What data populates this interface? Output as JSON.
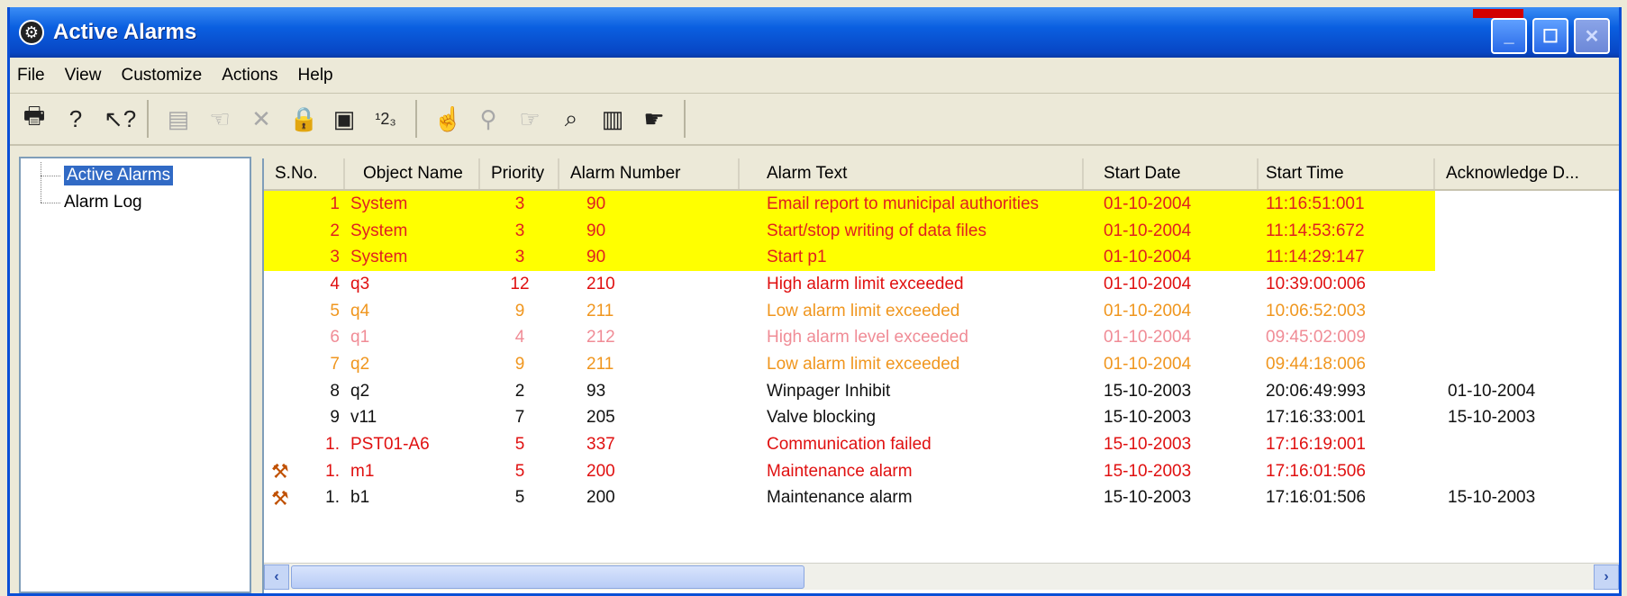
{
  "window": {
    "title": "Active Alarms"
  },
  "menu": [
    "File",
    "View",
    "Customize",
    "Actions",
    "Help"
  ],
  "tree": {
    "items": [
      {
        "label": "Active Alarms",
        "selected": true
      },
      {
        "label": "Alarm Log",
        "selected": false
      }
    ]
  },
  "table": {
    "columns": [
      "S.No.",
      "Object Name",
      "Priority",
      "Alarm Number",
      "Alarm Text",
      "Start Date",
      "Start Time",
      "Acknowledge D..."
    ],
    "rows": [
      {
        "sno": "1",
        "object": "System",
        "priority": "3",
        "number": "90",
        "text": "Email report to municipal authorities",
        "date": "01-10-2004",
        "time": "11:16:51:001",
        "ack": "",
        "style": "yellow",
        "color": "#e02020",
        "icon": ""
      },
      {
        "sno": "2",
        "object": "System",
        "priority": "3",
        "number": "90",
        "text": "Start/stop writing of data files",
        "date": "01-10-2004",
        "time": "11:14:53:672",
        "ack": "",
        "style": "yellow",
        "color": "#e02020",
        "icon": ""
      },
      {
        "sno": "3",
        "object": "System",
        "priority": "3",
        "number": "90",
        "text": "Start p1",
        "date": "01-10-2004",
        "time": "11:14:29:147",
        "ack": "",
        "style": "yellow",
        "color": "#e02020",
        "icon": ""
      },
      {
        "sno": "4",
        "object": "q3",
        "priority": "12",
        "number": "210",
        "text": "High alarm limit exceeded",
        "date": "01-10-2004",
        "time": "10:39:00:006",
        "ack": "",
        "style": "",
        "color": "#e01010",
        "icon": ""
      },
      {
        "sno": "5",
        "object": "q4",
        "priority": "9",
        "number": "211",
        "text": "Low alarm limit exceeded",
        "date": "01-10-2004",
        "time": "10:06:52:003",
        "ack": "",
        "style": "",
        "color": "#f0961e",
        "icon": ""
      },
      {
        "sno": "6",
        "object": "q1",
        "priority": "4",
        "number": "212",
        "text": "High alarm level exceeded",
        "date": "01-10-2004",
        "time": "09:45:02:009",
        "ack": "",
        "style": "",
        "color": "#f08c96",
        "icon": ""
      },
      {
        "sno": "7",
        "object": "q2",
        "priority": "9",
        "number": "211",
        "text": "Low alarm limit exceeded",
        "date": "01-10-2004",
        "time": "09:44:18:006",
        "ack": "",
        "style": "",
        "color": "#f0961e",
        "icon": ""
      },
      {
        "sno": "8",
        "object": "q2",
        "priority": "2",
        "number": "93",
        "text": "Winpager Inhibit",
        "date": "15-10-2003",
        "time": "20:06:49:993",
        "ack": "01-10-2004",
        "style": "",
        "color": "#111111",
        "icon": ""
      },
      {
        "sno": "9",
        "object": "v11",
        "priority": "7",
        "number": "205",
        "text": "Valve blocking",
        "date": "15-10-2003",
        "time": "17:16:33:001",
        "ack": "15-10-2003",
        "style": "",
        "color": "#111111",
        "icon": ""
      },
      {
        "sno": "1.",
        "object": "PST01-A6",
        "priority": "5",
        "number": "337",
        "text": "Communication failed",
        "date": "15-10-2003",
        "time": "17:16:19:001",
        "ack": "",
        "style": "",
        "color": "#e01010",
        "icon": ""
      },
      {
        "sno": "1.",
        "object": "m1",
        "priority": "5",
        "number": "200",
        "text": "Maintenance alarm",
        "date": "15-10-2003",
        "time": "17:16:01:506",
        "ack": "",
        "style": "",
        "color": "#e01010",
        "icon": "wrench-icon"
      },
      {
        "sno": "1.",
        "object": "b1",
        "priority": "5",
        "number": "200",
        "text": "Maintenance alarm",
        "date": "15-10-2003",
        "time": "17:16:01:506",
        "ack": "15-10-2003",
        "style": "",
        "color": "#111111",
        "icon": "wrench-icon"
      }
    ]
  },
  "colors": {
    "highlight": "#ffff00",
    "title_bar": "#0a5fe0",
    "selection": "#316ac5"
  },
  "icons": {
    "toolbar_group1": [
      "print-icon",
      "help-icon",
      "context-help-icon"
    ],
    "toolbar_group2": [
      "properties-icon",
      "acknowledge-icon",
      "delete-icon",
      "lock-icon",
      "filter-icon",
      "sort-icon"
    ],
    "toolbar_group3": [
      "ack-all-icon",
      "find-icon",
      "hide-icon",
      "zoom-icon",
      "report-icon",
      "alarm-check-icon"
    ]
  }
}
